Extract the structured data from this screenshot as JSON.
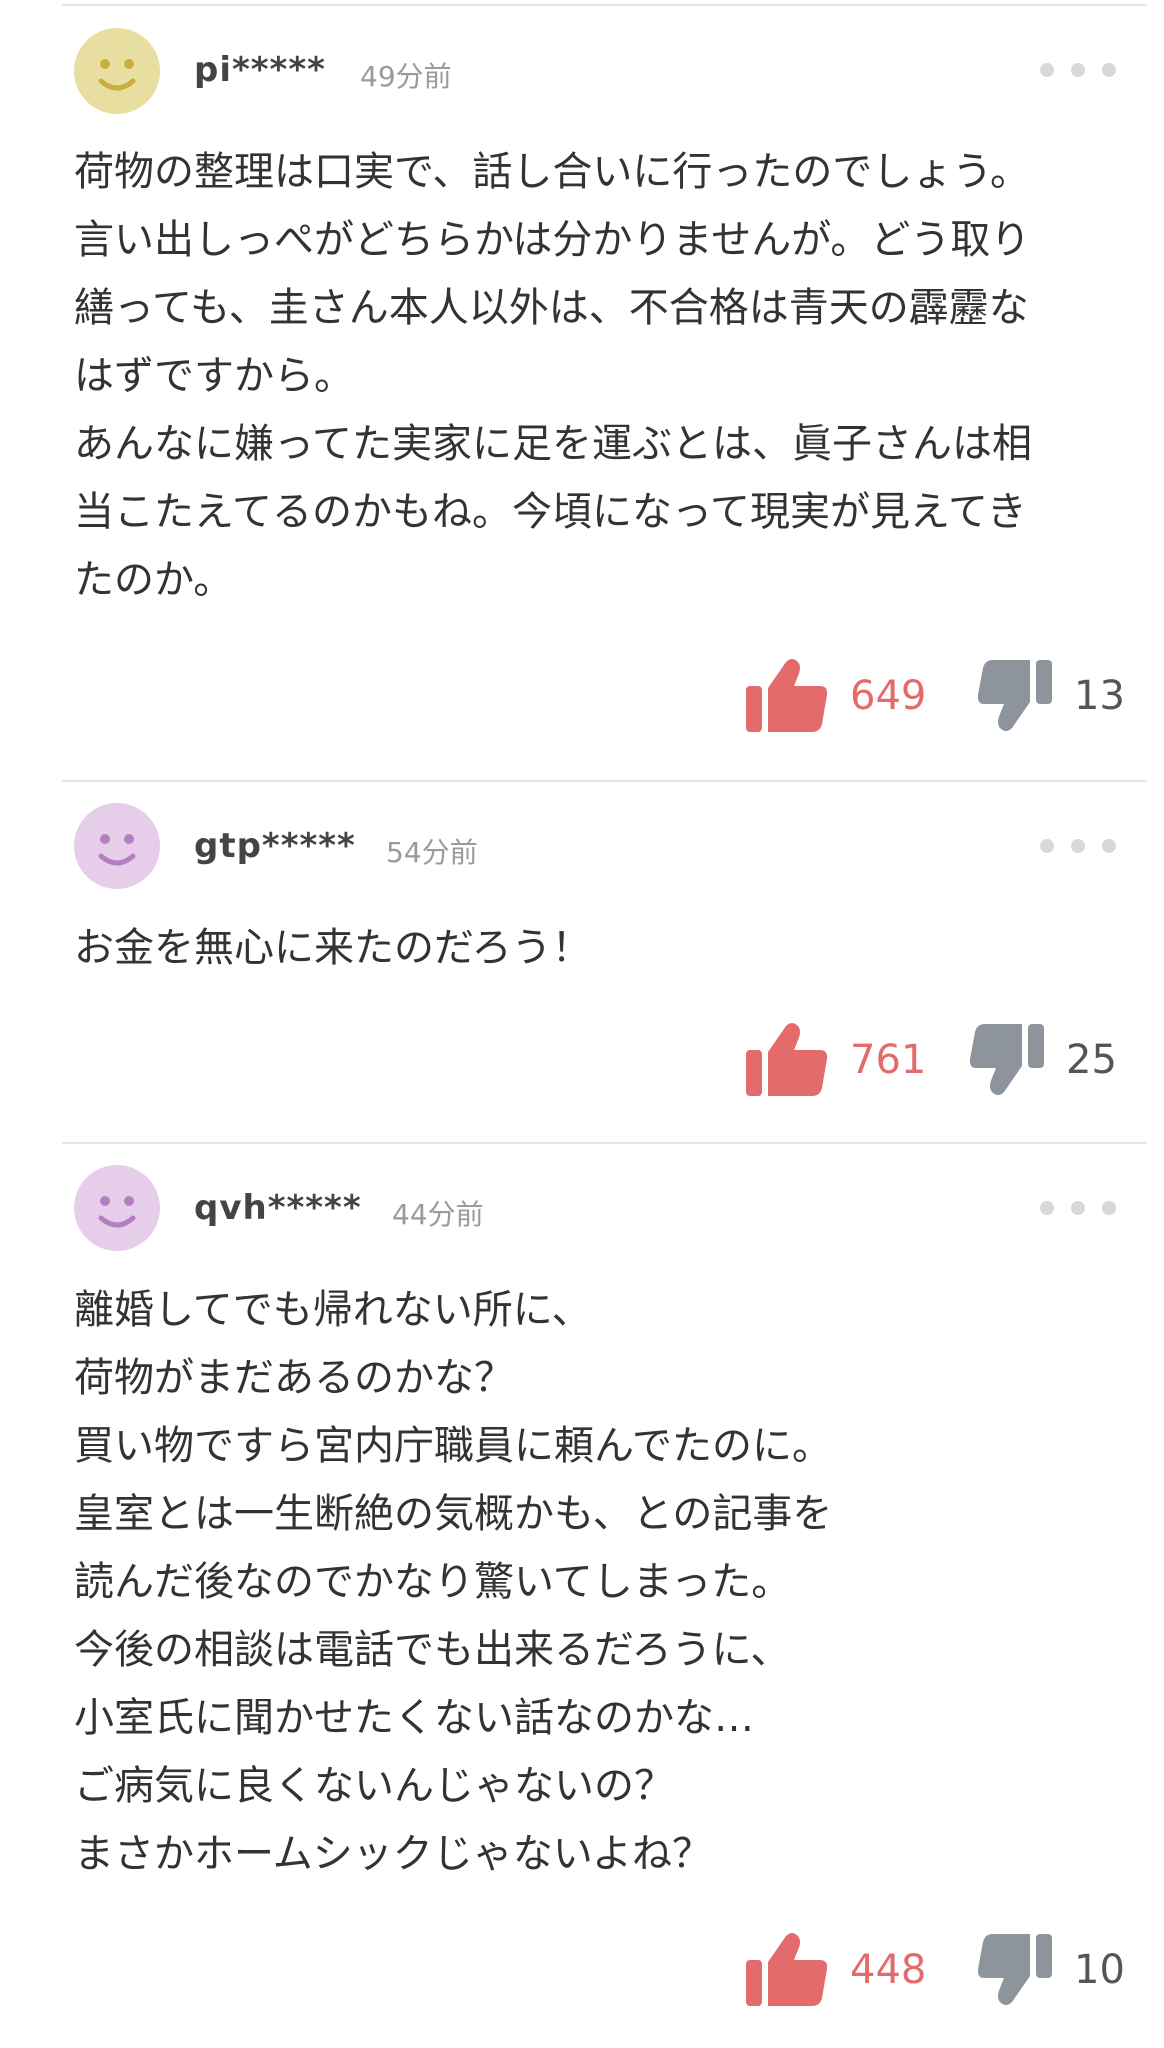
{
  "colors": {
    "like": "#e46b6b",
    "dislike": "#8e949c",
    "divider": "#e6e6e6",
    "avatar_yellow": "#e8dea0",
    "avatar_purple": "#e6cdea"
  },
  "comments": [
    {
      "username": "pi*****",
      "timestamp": "49分前",
      "avatar_color": "yellow",
      "body_lines": [
        "荷物の整理は口実で、話し合いに行ったのでしょう。",
        "言い出しっぺがどちらかは分かりませんが。どう取り",
        "繕っても、圭さん本人以外は、不合格は青天の霹靂な",
        "はずですから。",
        "あんなに嫌ってた実家に足を運ぶとは、眞子さんは相",
        "当こたえてるのかもね。今頃になって現実が見えてき",
        "たのか。"
      ],
      "likes": "649",
      "dislikes": "13"
    },
    {
      "username": "gtp*****",
      "timestamp": "54分前",
      "avatar_color": "purple",
      "body_lines": [
        "お金を無心に来たのだろう！"
      ],
      "likes": "761",
      "dislikes": "25"
    },
    {
      "username": "qvh*****",
      "timestamp": "44分前",
      "avatar_color": "purple",
      "body_lines": [
        "離婚してでも帰れない所に、",
        "荷物がまだあるのかな？",
        "買い物ですら宮内庁職員に頼んでたのに。",
        "皇室とは一生断絶の気概かも、との記事を",
        "読んだ後なのでかなり驚いてしまった。",
        "今後の相談は電話でも出来るだろうに、",
        "小室氏に聞かせたくない話なのかな…",
        "ご病気に良くないんじゃないの？",
        "まさかホームシックじゃないよね？"
      ],
      "likes": "448",
      "dislikes": "10"
    }
  ]
}
